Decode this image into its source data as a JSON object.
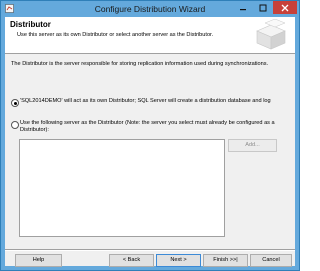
{
  "window": {
    "title": "Configure Distribution Wizard"
  },
  "header": {
    "title": "Distributor",
    "description": "Use this server as its own Distributor or select another server as the Distributor."
  },
  "body": {
    "description": "The Distributor is the server responsible for storing replication information used during synchronizations.",
    "option1_label": "'SQL2014DEMO' will act as its own Distributor; SQL Server will create a distribution database and log",
    "option2_label": "Use the following server as the Distributor (Note: the server you select must already be configured as a Distributor):",
    "selected_option": "option1"
  },
  "buttons": {
    "add": "Add...",
    "help": "Help",
    "back": "< Back",
    "next": "Next >",
    "finish": "Finish >>|",
    "cancel": "Cancel"
  },
  "colors": {
    "titlebar": "#64a9dc",
    "close": "#c7413a"
  }
}
